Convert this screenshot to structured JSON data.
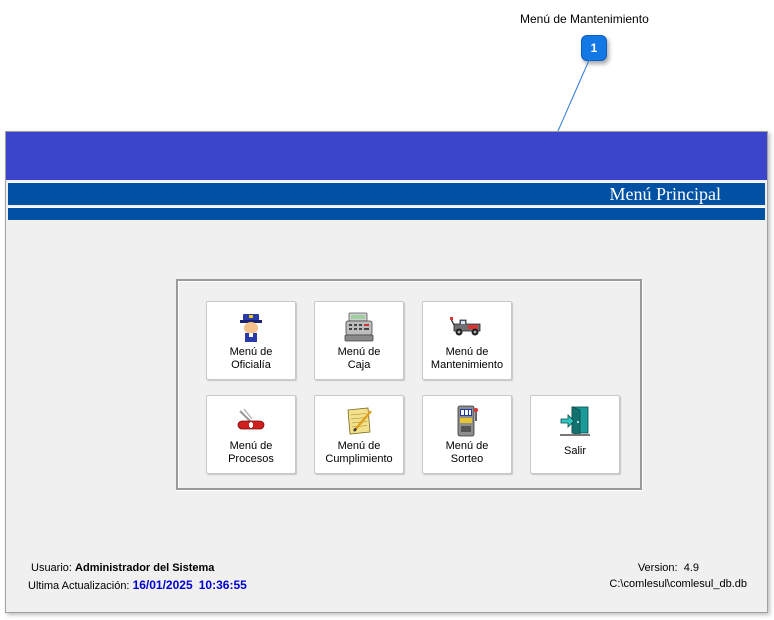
{
  "callout": {
    "label": "Menú de Mantenimiento",
    "number": "1"
  },
  "window": {
    "title": "Menú Principal"
  },
  "buttons": [
    {
      "line1": "Menú de",
      "line2": "Oficialía",
      "icon": "officer-icon"
    },
    {
      "line1": "Menú de",
      "line2": "Caja",
      "icon": "cash-register-icon"
    },
    {
      "line1": "Menú de",
      "line2": "Mantenimiento",
      "icon": "tow-truck-icon"
    },
    {
      "line1": "Menú de",
      "line2": "Procesos",
      "icon": "swiss-knife-icon"
    },
    {
      "line1": "Menú de",
      "line2": "Cumplimiento",
      "icon": "notepad-pencil-icon"
    },
    {
      "line1": "Menú de",
      "line2": "Sorteo",
      "icon": "slot-machine-icon"
    },
    {
      "line1": "Salir",
      "line2": "",
      "icon": "exit-door-icon"
    }
  ],
  "status": {
    "user_label": "Usuario:",
    "user_name": "Administrador del Sistema",
    "update_label": "Ultima Actualización:",
    "update_date": "16/01/2025",
    "update_time": "10:36:55",
    "version_label": "Version:",
    "version_value": "4.9",
    "db_path": "C:\\comlesul\\comlesul_db.db"
  },
  "colors": {
    "top_band": "#3b45cc",
    "title_band": "#0051a3",
    "callout_badge": "#1477e6",
    "status_blue": "#0000cc"
  }
}
